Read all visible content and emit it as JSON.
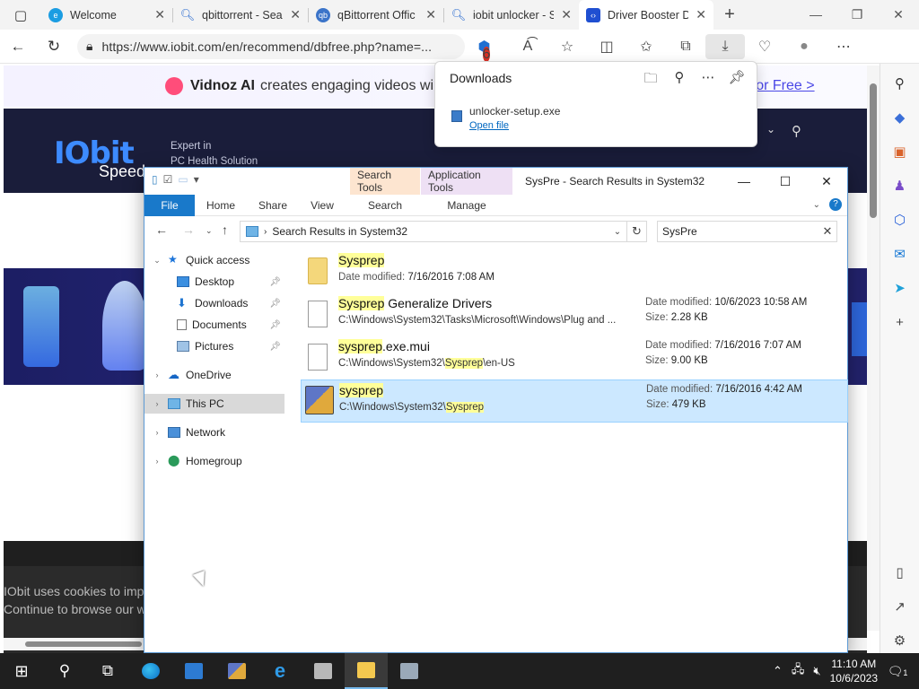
{
  "browser": {
    "tabs": [
      {
        "title": "Welcome",
        "icon": "edge-icon",
        "color": "#1b9de2"
      },
      {
        "title": "qbittorrent - Sea",
        "icon": "search-icon",
        "color": "#2b6bd0"
      },
      {
        "title": "qBittorrent Offic",
        "icon": "qbittorrent-icon",
        "color": "#3b74c9"
      },
      {
        "title": "iobit unlocker - S",
        "icon": "search-icon",
        "color": "#2b6bd0"
      },
      {
        "title": "Driver Booster D",
        "icon": "iobit-icon",
        "color": "#1f4fd1"
      }
    ],
    "url": "https://www.iobit.com/en/recommend/dbfree.php?name=...",
    "extension_badge": "6"
  },
  "webpage": {
    "promo_brand": "Vidnoz AI",
    "promo_text": "creates engaging videos wi",
    "promo_cta": "ry for Free >",
    "logo": "IObit",
    "logo_sub": "Speed",
    "expert_line1": "Expert in",
    "expert_line2": "PC Health Solution",
    "cookie_line1": "IObit uses cookies to imp",
    "cookie_line2": "Continue to browse our w"
  },
  "downloads": {
    "title": "Downloads",
    "file_name": "unlocker-setup.exe",
    "open_link": "Open file"
  },
  "explorer": {
    "context_search": "Search Tools",
    "context_app": "Application Tools",
    "window_title": "SysPre - Search Results in System32",
    "ribbon": {
      "file": "File",
      "home": "Home",
      "share": "Share",
      "view": "View",
      "search": "Search",
      "manage": "Manage"
    },
    "address": "Search Results in System32",
    "search_query": "SysPre",
    "nav": {
      "quick_access": "Quick access",
      "desktop": "Desktop",
      "downloads": "Downloads",
      "documents": "Documents",
      "pictures": "Pictures",
      "onedrive": "OneDrive",
      "this_pc": "This PC",
      "network": "Network",
      "homegroup": "Homegroup"
    },
    "results": [
      {
        "name_hl": "Sysprep",
        "name_rest": "",
        "date_label": "Date modified:",
        "date": "7/16/2016 7:08 AM",
        "type": "folder"
      },
      {
        "name_hl": "Sysprep",
        "name_rest": " Generalize Drivers",
        "path_pre": "C:\\Windows\\System32\\Tasks\\Microsoft\\Windows\\Plug and ...",
        "path_hl": "",
        "path_post": "",
        "date_label": "Date modified:",
        "date": "10/6/2023 10:58 AM",
        "size_label": "Size:",
        "size": "2.28 KB",
        "type": "file"
      },
      {
        "name_hl": "sysprep",
        "name_rest": ".exe.mui",
        "path_pre": "C:\\Windows\\System32\\",
        "path_hl": "Sysprep",
        "path_post": "\\en-US",
        "date_label": "Date modified:",
        "date": "7/16/2016 7:07 AM",
        "size_label": "Size:",
        "size": "9.00 KB",
        "type": "file"
      },
      {
        "name_hl": "sysprep",
        "name_rest": "",
        "path_pre": "C:\\Windows\\System32\\",
        "path_hl": "Sysprep",
        "path_post": "",
        "date_label": "Date modified:",
        "date": "7/16/2016 4:42 AM",
        "size_label": "Size:",
        "size": "479 KB",
        "type": "exe"
      }
    ]
  },
  "taskbar": {
    "time": "11:10 AM",
    "date": "10/6/2023",
    "notification_count": "1"
  }
}
